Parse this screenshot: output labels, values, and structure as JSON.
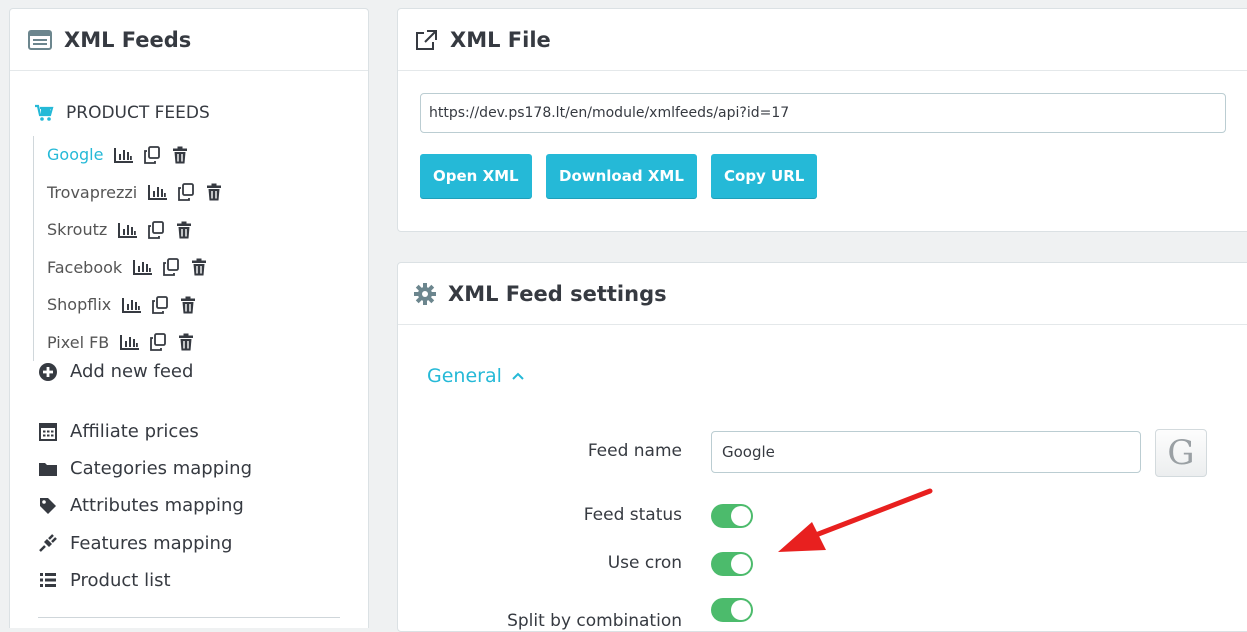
{
  "sidebar": {
    "title": "XML Feeds",
    "section_title": "PRODUCT FEEDS",
    "feeds": [
      {
        "label": "Google",
        "active": true
      },
      {
        "label": "Trovaprezzi",
        "active": false
      },
      {
        "label": "Skroutz",
        "active": false
      },
      {
        "label": "Facebook",
        "active": false
      },
      {
        "label": "Shopflix",
        "active": false
      },
      {
        "label": "Pixel FB",
        "active": false
      }
    ],
    "add_feed_label": "Add new feed",
    "menu": [
      {
        "label": "Affiliate prices",
        "icon": "calculator-icon"
      },
      {
        "label": "Categories mapping",
        "icon": "folder-icon"
      },
      {
        "label": "Attributes mapping",
        "icon": "tag-icon"
      },
      {
        "label": "Features mapping",
        "icon": "plug-icon"
      },
      {
        "label": "Product list",
        "icon": "list-icon"
      }
    ]
  },
  "xml_file": {
    "title": "XML File",
    "url": "https://dev.ps178.lt/en/module/xmlfeeds/api?id=17",
    "open_label": "Open XML",
    "download_label": "Download XML",
    "copy_label": "Copy URL"
  },
  "settings": {
    "title": "XML Feed settings",
    "general_label": "General",
    "feed_name_label": "Feed name",
    "feed_name_value": "Google",
    "google_badge": "G",
    "feed_status_label": "Feed status",
    "feed_status_on": true,
    "use_cron_label": "Use cron",
    "use_cron_on": true,
    "split_label": "Split by combination",
    "split_on": true
  },
  "colors": {
    "accent": "#25b9d7",
    "switch_on": "#4cbb6c",
    "arrow": "#e8201f"
  }
}
